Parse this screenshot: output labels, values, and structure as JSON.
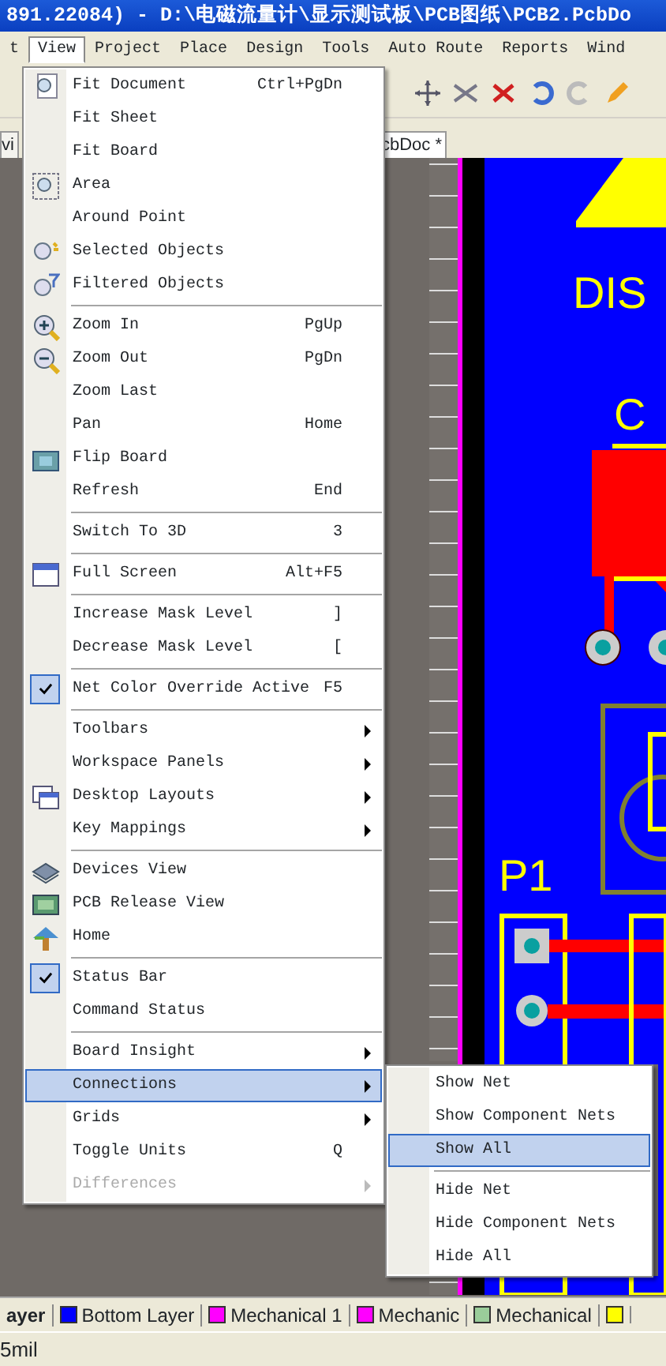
{
  "window": {
    "title": "891.22084) - D:\\电磁流量计\\显示测试板\\PCB图纸\\PCB2.PcbDo"
  },
  "menu_bar": [
    {
      "label": "t",
      "selected": false
    },
    {
      "label": "View",
      "selected": true
    },
    {
      "label": "Project",
      "selected": false
    },
    {
      "label": "Place",
      "selected": false
    },
    {
      "label": "Design",
      "selected": false
    },
    {
      "label": "Tools",
      "selected": false
    },
    {
      "label": "Auto Route",
      "selected": false
    },
    {
      "label": "Reports",
      "selected": false
    },
    {
      "label": "Wind",
      "selected": false
    }
  ],
  "document_tabs": [
    {
      "label": "vi",
      "selected": false
    },
    {
      "label": "cbDoc *",
      "selected": true
    }
  ],
  "view_menu": [
    {
      "kind": "item",
      "label": "Fit Document",
      "shortcut": "Ctrl+PgDn"
    },
    {
      "kind": "item",
      "label": "Fit Sheet"
    },
    {
      "kind": "item",
      "label": "Fit Board"
    },
    {
      "kind": "item",
      "label": "Area"
    },
    {
      "kind": "item",
      "label": "Around Point"
    },
    {
      "kind": "item",
      "label": "Selected Objects"
    },
    {
      "kind": "item",
      "label": "Filtered Objects"
    },
    {
      "kind": "separator"
    },
    {
      "kind": "item",
      "label": "Zoom In",
      "shortcut": "PgUp"
    },
    {
      "kind": "item",
      "label": "Zoom Out",
      "shortcut": "PgDn"
    },
    {
      "kind": "item",
      "label": "Zoom Last"
    },
    {
      "kind": "item",
      "label": "Pan",
      "shortcut": "Home"
    },
    {
      "kind": "item",
      "label": "Flip Board"
    },
    {
      "kind": "item",
      "label": "Refresh",
      "shortcut": "End"
    },
    {
      "kind": "separator"
    },
    {
      "kind": "item",
      "label": "Switch To 3D",
      "shortcut": "3"
    },
    {
      "kind": "separator"
    },
    {
      "kind": "item",
      "label": "Full Screen",
      "shortcut": "Alt+F5"
    },
    {
      "kind": "separator"
    },
    {
      "kind": "item",
      "label": "Increase Mask Level",
      "shortcut": "]"
    },
    {
      "kind": "item",
      "label": "Decrease Mask Level",
      "shortcut": "["
    },
    {
      "kind": "separator"
    },
    {
      "kind": "item",
      "label": "Net Color Override Active",
      "shortcut": "F5",
      "checked": true
    },
    {
      "kind": "separator"
    },
    {
      "kind": "item",
      "label": "Toolbars",
      "submenu": true
    },
    {
      "kind": "item",
      "label": "Workspace Panels",
      "submenu": true
    },
    {
      "kind": "item",
      "label": "Desktop Layouts",
      "submenu": true
    },
    {
      "kind": "item",
      "label": "Key Mappings",
      "submenu": true
    },
    {
      "kind": "separator"
    },
    {
      "kind": "item",
      "label": "Devices View"
    },
    {
      "kind": "item",
      "label": "PCB Release View"
    },
    {
      "kind": "item",
      "label": "Home"
    },
    {
      "kind": "separator"
    },
    {
      "kind": "item",
      "label": "Status Bar",
      "checked": true
    },
    {
      "kind": "item",
      "label": "Command Status"
    },
    {
      "kind": "separator"
    },
    {
      "kind": "item",
      "label": "Board Insight",
      "submenu": true
    },
    {
      "kind": "item",
      "label": "Connections",
      "submenu": true,
      "selected": true
    },
    {
      "kind": "item",
      "label": "Grids",
      "submenu": true
    },
    {
      "kind": "item",
      "label": "Toggle Units",
      "shortcut": "Q"
    },
    {
      "kind": "item",
      "label": "Differences",
      "submenu": true,
      "disabled": true
    }
  ],
  "connections_submenu": [
    {
      "kind": "item",
      "label": "Show Net"
    },
    {
      "kind": "item",
      "label": "Show Component Nets"
    },
    {
      "kind": "item",
      "label": "Show All",
      "selected": true
    },
    {
      "kind": "separator"
    },
    {
      "kind": "item",
      "label": "Hide Net"
    },
    {
      "kind": "item",
      "label": "Hide Component Nets"
    },
    {
      "kind": "item",
      "label": "Hide All"
    }
  ],
  "pcb_labels": [
    "DIS",
    "C",
    "P1"
  ],
  "layer_tabs": [
    {
      "label": "ayer",
      "selected": true
    },
    {
      "label": "Bottom Layer",
      "color": "#0000ff",
      "selected": false
    },
    {
      "label": "Mechanical 1",
      "color": "#ff00ff",
      "selected": false
    },
    {
      "label": "Mechanic",
      "color": "#ff00ff",
      "selected": false
    },
    {
      "label": "Mechanical",
      "color": "#9acd9a",
      "selected": false
    },
    {
      "color": "#ffff00"
    }
  ],
  "status_bar": {
    "text": "5mil"
  }
}
